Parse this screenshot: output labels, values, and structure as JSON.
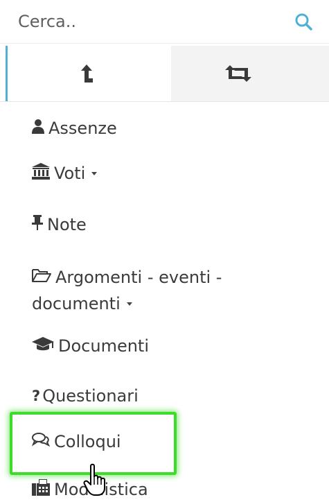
{
  "search": {
    "placeholder": "Cerca..",
    "icon": "search-icon"
  },
  "tabs": [
    {
      "icon": "arrow-up-icon",
      "active": true
    },
    {
      "icon": "retweet-icon",
      "active": false
    }
  ],
  "menu": {
    "items": [
      {
        "icon": "user-icon",
        "label": "Assenze"
      },
      {
        "icon": "bank-icon",
        "label": "Voti"
      },
      {
        "icon": "pushpin-icon",
        "label": "Note"
      },
      {
        "icon": "folder-open-icon",
        "label_line1": "Argomenti - eventi -",
        "label_line2": "documenti"
      },
      {
        "icon": "graduation-cap-icon",
        "label": "Documenti"
      },
      {
        "icon": "question-icon",
        "label": "Questionari"
      },
      {
        "icon": "comments-icon",
        "label": "Colloqui"
      },
      {
        "icon": "fax-icon",
        "label": "Modulistica"
      }
    ]
  },
  "colors": {
    "accent": "#4fb0d3",
    "highlight": "#3ddc2a",
    "text": "#3b3b3b"
  }
}
